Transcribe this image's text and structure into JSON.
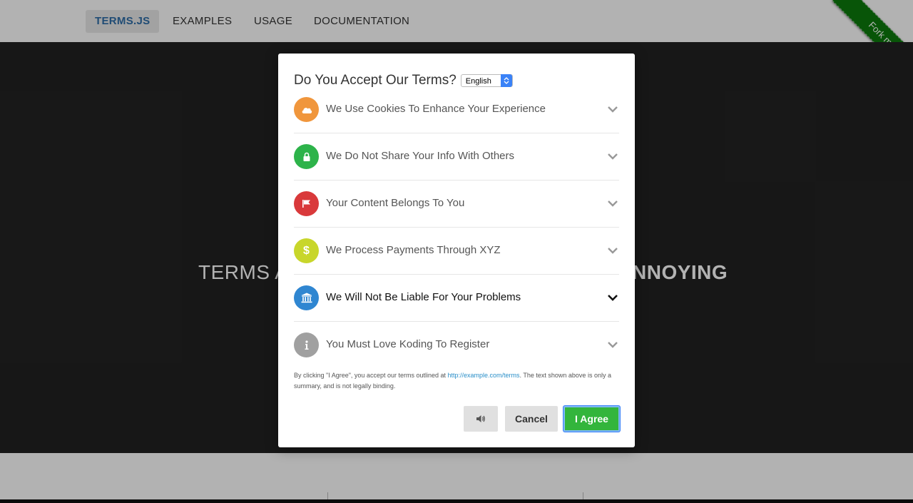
{
  "nav": {
    "items": [
      "TERMS.JS",
      "EXAMPLES",
      "USAGE",
      "DOCUMENTATION"
    ]
  },
  "hero": {
    "left_text": "TERMS A",
    "right_text": "NNOYING"
  },
  "ribbon": {
    "label": "Fork me on GitHub"
  },
  "modal": {
    "title": "Do You Accept Our Terms?",
    "language": "English",
    "terms": [
      {
        "label": "We Use Cookies To Enhance Your Experience",
        "icon": "cloud-icon",
        "color": "#f0963c"
      },
      {
        "label": "We Do Not Share Your Info With Others",
        "icon": "lock-icon",
        "color": "#2db34a"
      },
      {
        "label": "Your Content Belongs To You",
        "icon": "flag-icon",
        "color": "#d9393b"
      },
      {
        "label": "We Process Payments Through XYZ",
        "icon": "dollar-icon",
        "color": "#c8d62b"
      },
      {
        "label": "We Will Not Be Liable For Your Problems",
        "icon": "bank-icon",
        "color": "#2f86d1"
      },
      {
        "label": "You Must Love Koding To Register",
        "icon": "info-icon",
        "color": "#a0a0a0"
      }
    ],
    "active_term": "We Will Not Be Liable For Your Problems",
    "disclaimer_prefix": "By clicking \"I Agree\", you accept our terms outlined at ",
    "disclaimer_link": "http://example.com/terms",
    "disclaimer_suffix": ". The text shown above is only a summary, and is not legally binding.",
    "buttons": {
      "audio_icon": "speaker-icon",
      "cancel": "Cancel",
      "agree": "I Agree"
    }
  }
}
